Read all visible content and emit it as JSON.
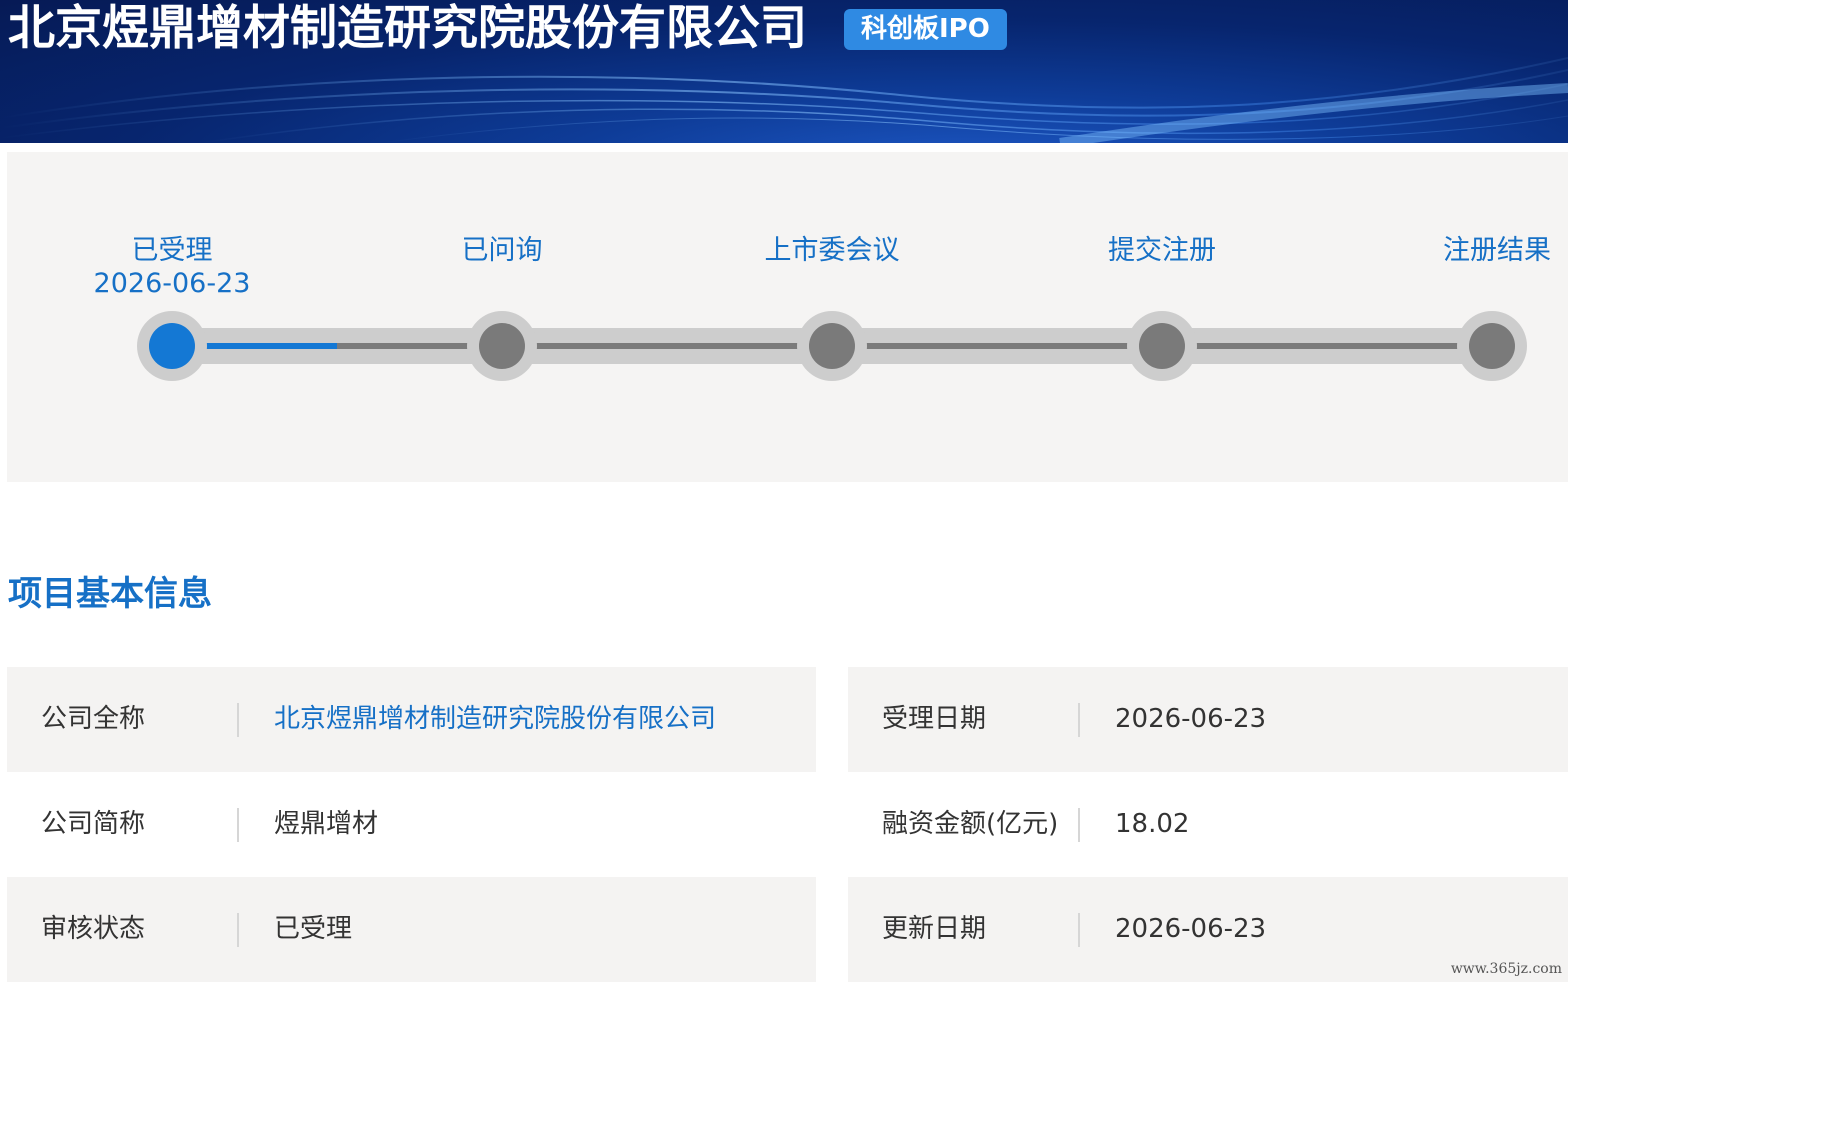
{
  "header": {
    "company_title": "北京煜鼎增材制造研究院股份有限公司",
    "board_badge": "科创板IPO"
  },
  "progress": {
    "current_step_index": 0,
    "steps": [
      {
        "label": "已受理",
        "date": "2026-06-23"
      },
      {
        "label": "已问询",
        "date": ""
      },
      {
        "label": "上市委会议",
        "date": ""
      },
      {
        "label": "提交注册",
        "date": ""
      },
      {
        "label": "注册结果",
        "date": ""
      }
    ],
    "fill_fraction_of_first_segment": 0.5
  },
  "section": {
    "title": "项目基本信息"
  },
  "info": {
    "left": [
      {
        "key": "公司全称",
        "value": "北京煜鼎增材制造研究院股份有限公司",
        "is_link": true
      },
      {
        "key": "公司简称",
        "value": "煜鼎增材",
        "is_link": false
      },
      {
        "key": "审核状态",
        "value": "已受理",
        "is_link": false
      }
    ],
    "right": [
      {
        "key": "受理日期",
        "value": "2026-06-23"
      },
      {
        "key": "融资金额(亿元)",
        "value": "18.02"
      },
      {
        "key": "更新日期",
        "value": "2026-06-23"
      }
    ]
  },
  "watermark": "www.365jz.com",
  "colors": {
    "header_dark": "#061a55",
    "badge": "#2f8ae3",
    "accent_blue": "#1670c6",
    "active_node": "#1478d4",
    "inactive_node": "#7a7a7a",
    "panel_bg": "#f5f4f3"
  }
}
